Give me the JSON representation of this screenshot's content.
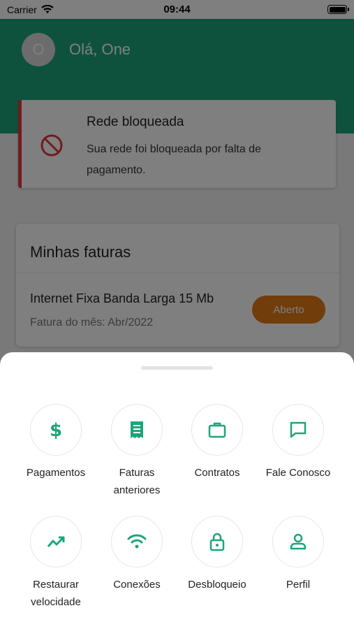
{
  "status_bar": {
    "carrier": "Carrier",
    "time": "09:44"
  },
  "header": {
    "avatar_initial": "O",
    "greeting": "Olá, One",
    "color": "#1da57a"
  },
  "alert": {
    "title": "Rede bloqueada",
    "message": "Sua rede foi bloqueada por falta de pagamento.",
    "icon": "blocked-icon",
    "accent_color": "#e53935"
  },
  "invoices": {
    "title": "Minhas faturas",
    "items": [
      {
        "name": "Internet Fixa Banda Larga 15 Mb",
        "period": "Fatura do mês: Abr/2022",
        "status": "Aberto",
        "status_color": "#e07a17"
      }
    ]
  },
  "sheet": {
    "icon_color": "#1da57a",
    "actions": [
      {
        "label": "Pagamentos",
        "icon": "dollar-icon"
      },
      {
        "label": "Faturas anteriores",
        "icon": "receipt-icon"
      },
      {
        "label": "Contratos",
        "icon": "briefcase-icon"
      },
      {
        "label": "Fale Conosco",
        "icon": "chat-icon"
      },
      {
        "label": "Restaurar velocidade",
        "icon": "trending-up-icon"
      },
      {
        "label": "Conexões",
        "icon": "wifi-icon"
      },
      {
        "label": "Desbloqueio",
        "icon": "lock-icon"
      },
      {
        "label": "Perfil",
        "icon": "user-icon"
      }
    ]
  }
}
